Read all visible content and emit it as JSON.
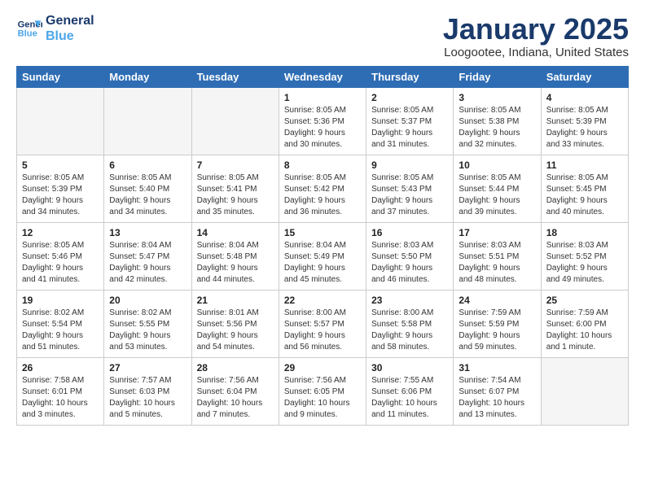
{
  "logo": {
    "line1": "General",
    "line2": "Blue"
  },
  "title": "January 2025",
  "subtitle": "Loogootee, Indiana, United States",
  "days_of_week": [
    "Sunday",
    "Monday",
    "Tuesday",
    "Wednesday",
    "Thursday",
    "Friday",
    "Saturday"
  ],
  "weeks": [
    [
      {
        "day": "",
        "info": ""
      },
      {
        "day": "",
        "info": ""
      },
      {
        "day": "",
        "info": ""
      },
      {
        "day": "1",
        "info": "Sunrise: 8:05 AM\nSunset: 5:36 PM\nDaylight: 9 hours\nand 30 minutes."
      },
      {
        "day": "2",
        "info": "Sunrise: 8:05 AM\nSunset: 5:37 PM\nDaylight: 9 hours\nand 31 minutes."
      },
      {
        "day": "3",
        "info": "Sunrise: 8:05 AM\nSunset: 5:38 PM\nDaylight: 9 hours\nand 32 minutes."
      },
      {
        "day": "4",
        "info": "Sunrise: 8:05 AM\nSunset: 5:39 PM\nDaylight: 9 hours\nand 33 minutes."
      }
    ],
    [
      {
        "day": "5",
        "info": "Sunrise: 8:05 AM\nSunset: 5:39 PM\nDaylight: 9 hours\nand 34 minutes."
      },
      {
        "day": "6",
        "info": "Sunrise: 8:05 AM\nSunset: 5:40 PM\nDaylight: 9 hours\nand 34 minutes."
      },
      {
        "day": "7",
        "info": "Sunrise: 8:05 AM\nSunset: 5:41 PM\nDaylight: 9 hours\nand 35 minutes."
      },
      {
        "day": "8",
        "info": "Sunrise: 8:05 AM\nSunset: 5:42 PM\nDaylight: 9 hours\nand 36 minutes."
      },
      {
        "day": "9",
        "info": "Sunrise: 8:05 AM\nSunset: 5:43 PM\nDaylight: 9 hours\nand 37 minutes."
      },
      {
        "day": "10",
        "info": "Sunrise: 8:05 AM\nSunset: 5:44 PM\nDaylight: 9 hours\nand 39 minutes."
      },
      {
        "day": "11",
        "info": "Sunrise: 8:05 AM\nSunset: 5:45 PM\nDaylight: 9 hours\nand 40 minutes."
      }
    ],
    [
      {
        "day": "12",
        "info": "Sunrise: 8:05 AM\nSunset: 5:46 PM\nDaylight: 9 hours\nand 41 minutes."
      },
      {
        "day": "13",
        "info": "Sunrise: 8:04 AM\nSunset: 5:47 PM\nDaylight: 9 hours\nand 42 minutes."
      },
      {
        "day": "14",
        "info": "Sunrise: 8:04 AM\nSunset: 5:48 PM\nDaylight: 9 hours\nand 44 minutes."
      },
      {
        "day": "15",
        "info": "Sunrise: 8:04 AM\nSunset: 5:49 PM\nDaylight: 9 hours\nand 45 minutes."
      },
      {
        "day": "16",
        "info": "Sunrise: 8:03 AM\nSunset: 5:50 PM\nDaylight: 9 hours\nand 46 minutes."
      },
      {
        "day": "17",
        "info": "Sunrise: 8:03 AM\nSunset: 5:51 PM\nDaylight: 9 hours\nand 48 minutes."
      },
      {
        "day": "18",
        "info": "Sunrise: 8:03 AM\nSunset: 5:52 PM\nDaylight: 9 hours\nand 49 minutes."
      }
    ],
    [
      {
        "day": "19",
        "info": "Sunrise: 8:02 AM\nSunset: 5:54 PM\nDaylight: 9 hours\nand 51 minutes."
      },
      {
        "day": "20",
        "info": "Sunrise: 8:02 AM\nSunset: 5:55 PM\nDaylight: 9 hours\nand 53 minutes."
      },
      {
        "day": "21",
        "info": "Sunrise: 8:01 AM\nSunset: 5:56 PM\nDaylight: 9 hours\nand 54 minutes."
      },
      {
        "day": "22",
        "info": "Sunrise: 8:00 AM\nSunset: 5:57 PM\nDaylight: 9 hours\nand 56 minutes."
      },
      {
        "day": "23",
        "info": "Sunrise: 8:00 AM\nSunset: 5:58 PM\nDaylight: 9 hours\nand 58 minutes."
      },
      {
        "day": "24",
        "info": "Sunrise: 7:59 AM\nSunset: 5:59 PM\nDaylight: 9 hours\nand 59 minutes."
      },
      {
        "day": "25",
        "info": "Sunrise: 7:59 AM\nSunset: 6:00 PM\nDaylight: 10 hours\nand 1 minute."
      }
    ],
    [
      {
        "day": "26",
        "info": "Sunrise: 7:58 AM\nSunset: 6:01 PM\nDaylight: 10 hours\nand 3 minutes."
      },
      {
        "day": "27",
        "info": "Sunrise: 7:57 AM\nSunset: 6:03 PM\nDaylight: 10 hours\nand 5 minutes."
      },
      {
        "day": "28",
        "info": "Sunrise: 7:56 AM\nSunset: 6:04 PM\nDaylight: 10 hours\nand 7 minutes."
      },
      {
        "day": "29",
        "info": "Sunrise: 7:56 AM\nSunset: 6:05 PM\nDaylight: 10 hours\nand 9 minutes."
      },
      {
        "day": "30",
        "info": "Sunrise: 7:55 AM\nSunset: 6:06 PM\nDaylight: 10 hours\nand 11 minutes."
      },
      {
        "day": "31",
        "info": "Sunrise: 7:54 AM\nSunset: 6:07 PM\nDaylight: 10 hours\nand 13 minutes."
      },
      {
        "day": "",
        "info": ""
      }
    ]
  ]
}
